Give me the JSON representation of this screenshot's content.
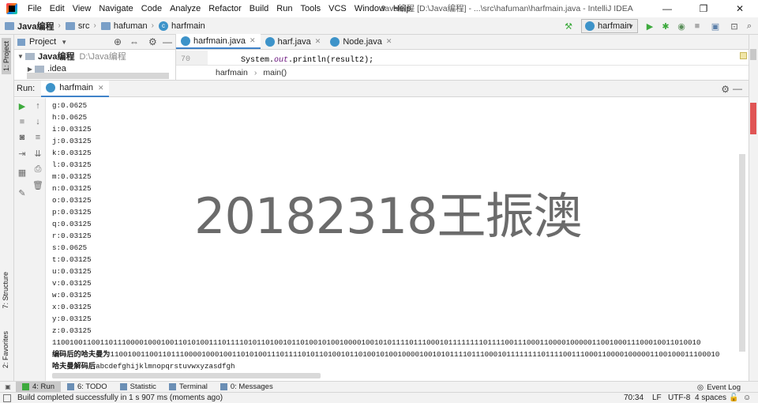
{
  "menu": [
    "File",
    "Edit",
    "View",
    "Navigate",
    "Code",
    "Analyze",
    "Refactor",
    "Build",
    "Run",
    "Tools",
    "VCS",
    "Window",
    "Help"
  ],
  "window_title": "Java编程 [D:\\Java编程] - ...\\src\\hafuman\\harfmain.java - IntelliJ IDEA",
  "window_controls": {
    "minimize": "—",
    "maximize": "❐",
    "close": "✕"
  },
  "navbar": {
    "breadcrumbs": [
      "Java编程",
      "src",
      "hafuman",
      "harfmain"
    ],
    "run_config": "harfmain"
  },
  "left_strip": {
    "project_tab": "1: Project",
    "structure_tab": "7: Structure",
    "favorites_tab": "2: Favorites"
  },
  "project_panel": {
    "title": "Project",
    "tree": [
      {
        "name": "Java编程",
        "path": "D:\\Java编程"
      },
      {
        "name": ".idea",
        "path": ""
      }
    ]
  },
  "editor": {
    "tabs": [
      {
        "label": "harfmain.java",
        "active": true
      },
      {
        "label": "harf.java",
        "active": false
      },
      {
        "label": "Node.java",
        "active": false
      }
    ],
    "line_number": "70",
    "code": {
      "prefix": "System.",
      "field": "out",
      "call": ".println(",
      "arg": "result2",
      "suffix": ");"
    },
    "breadcrumbs": [
      "harfmain",
      "main()"
    ]
  },
  "run_panel": {
    "label": "Run:",
    "tab": "harfmain",
    "output": [
      "g:0.0625",
      "h:0.0625",
      "i:0.03125",
      "j:0.03125",
      "k:0.03125",
      "l:0.03125",
      "m:0.03125",
      "n:0.03125",
      "o:0.03125",
      "p:0.03125",
      "q:0.03125",
      "r:0.03125",
      "s:0.0625",
      "t:0.03125",
      "u:0.03125",
      "v:0.03125",
      "w:0.03125",
      "x:0.03125",
      "y:0.03125",
      "z:0.03125",
      "11001001100110111000010001001101010011101111010110100101101001010010000100101011110111000101111111101111001110001100001000001100100011100010011010010"
    ],
    "encoded_label": "编码后的哈夫曼为",
    "encoded_value": "11001001100110111000010001001101010011101111010110100101101001010010000100101011110111000101111111101111001110001100001000001100100011100010",
    "decoded_label": "哈夫曼解码后",
    "decoded_value": "abcdefghijklmnopqrstuvwxyzasdfgh"
  },
  "watermark": "20182318王振澳",
  "bottom_tabs": [
    {
      "label": "4: Run",
      "active": true
    },
    {
      "label": "6: TODO",
      "active": false
    },
    {
      "label": "Statistic",
      "active": false
    },
    {
      "label": "Terminal",
      "active": false
    },
    {
      "label": "0: Messages",
      "active": false
    }
  ],
  "event_log": "Event Log",
  "status": {
    "message": "Build completed successfully in 1 s 907 ms (moments ago)",
    "position": "70:34",
    "line_sep": "LF",
    "encoding": "UTF-8",
    "indent": "4 spaces"
  },
  "colors": {
    "accent": "#4083c9",
    "run_green": "#3daa3d",
    "class_icon": "#3d93c9"
  }
}
